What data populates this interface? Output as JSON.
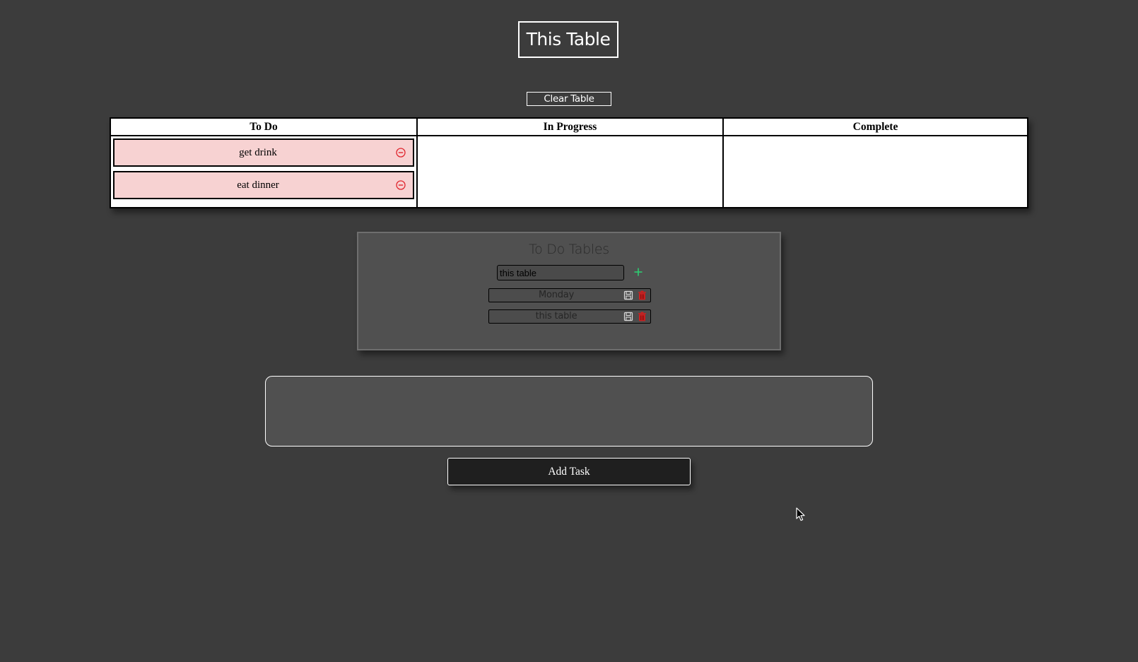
{
  "header": {
    "title": "This Table"
  },
  "toolbar": {
    "clear_label": "Clear Table"
  },
  "board": {
    "columns": [
      {
        "heading": "To Do",
        "tasks": [
          "get drink",
          "eat dinner"
        ]
      },
      {
        "heading": "In Progress",
        "tasks": []
      },
      {
        "heading": "Complete",
        "tasks": []
      }
    ]
  },
  "tables_panel": {
    "title": "To Do Tables",
    "input_value": "this table",
    "saved_tables": [
      "Monday",
      "this table"
    ]
  },
  "task_entry": {
    "value": ""
  },
  "add_task": {
    "label": "Add Task"
  },
  "colors": {
    "page_bg": "#3c3c3c",
    "task_bg": "#f7d2d2",
    "remove_icon": "#e0262e",
    "add_icon": "#2ecc71",
    "delete_icon": "#cc1f1f",
    "panel_bg": "#505050",
    "button_bg": "#1f1f1f"
  },
  "icons": {
    "remove_task": "minus-circle-icon",
    "add_table": "plus-icon",
    "save_table": "floppy-disk-icon",
    "delete_table": "trash-icon"
  }
}
